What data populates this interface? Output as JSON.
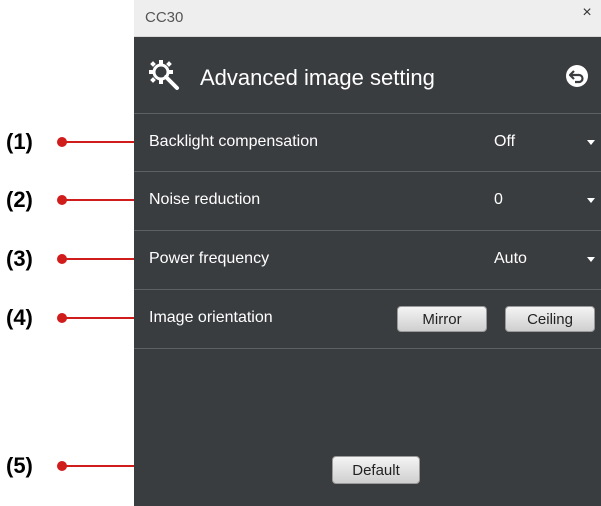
{
  "window": {
    "title": "CC30",
    "close_glyph": "×"
  },
  "header": {
    "title": "Advanced image setting",
    "icon": "gear-icon",
    "back_icon": "back-icon"
  },
  "rows": [
    {
      "label": "Backlight compensation",
      "value": "Off"
    },
    {
      "label": "Noise reduction",
      "value": "0"
    },
    {
      "label": "Power frequency",
      "value": "Auto"
    },
    {
      "label": "Image orientation",
      "buttons": [
        "Mirror",
        "Ceiling"
      ]
    }
  ],
  "footer": {
    "default_label": "Default"
  },
  "callouts": [
    "(1)",
    "(2)",
    "(3)",
    "(4)",
    "(5)"
  ],
  "colors": {
    "panel": "#3a3d40",
    "callout": "#d11c1c",
    "titlebar": "#eeeeee"
  }
}
